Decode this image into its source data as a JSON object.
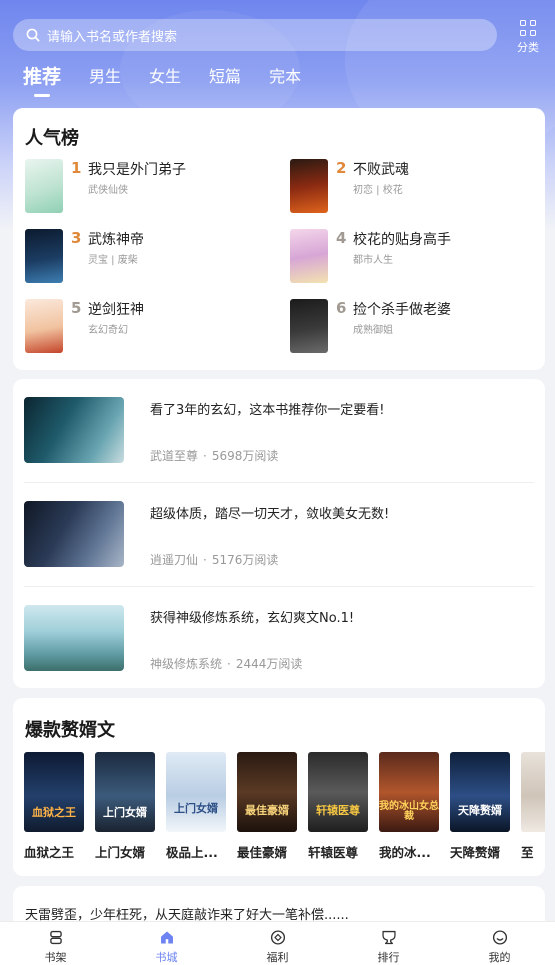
{
  "search": {
    "placeholder": "请输入书名或作者搜索"
  },
  "category": {
    "label": "分类"
  },
  "tabs": [
    {
      "label": "推荐",
      "active": true
    },
    {
      "label": "男生",
      "active": false
    },
    {
      "label": "女生",
      "active": false
    },
    {
      "label": "短篇",
      "active": false
    },
    {
      "label": "完本",
      "active": false
    }
  ],
  "ranking": {
    "title": "人气榜",
    "items": [
      {
        "rank": "1",
        "title": "我只是外门弟子",
        "tags": "武侠仙侠"
      },
      {
        "rank": "2",
        "title": "不败武魂",
        "tags": "初恋 | 校花"
      },
      {
        "rank": "3",
        "title": "武炼神帝",
        "tags": "灵宝 | 废柴"
      },
      {
        "rank": "4",
        "title": "校花的贴身高手",
        "tags": "都市人生"
      },
      {
        "rank": "5",
        "title": "逆剑狂神",
        "tags": "玄幻奇幻"
      },
      {
        "rank": "6",
        "title": "捡个杀手做老婆",
        "tags": "成熟御姐"
      }
    ]
  },
  "featured": [
    {
      "title": "看了3年的玄幻，这本书推荐你一定要看!",
      "book": "武道至尊",
      "reads": "5698万阅读"
    },
    {
      "title": "超级体质，踏尽一切天才，敛收美女无数!",
      "book": "逍遥刀仙",
      "reads": "5176万阅读"
    },
    {
      "title": "获得神级修炼系统，玄幻爽文No.1!",
      "book": "神级修炼系统",
      "reads": "2444万阅读"
    }
  ],
  "meta_separator": "·",
  "hot": {
    "title": "爆款赘婿文",
    "items": [
      {
        "name": "血狱之王",
        "cover_text": "血狱之王"
      },
      {
        "name": "上门女婿",
        "cover_text": "上门女婿"
      },
      {
        "name": "极品上...",
        "cover_text": "上门女婿"
      },
      {
        "name": "最佳豪婿",
        "cover_text": "最佳豪婿"
      },
      {
        "name": "轩辕医尊",
        "cover_text": "轩辕医尊"
      },
      {
        "name": "我的冰...",
        "cover_text": "我的冰山女总裁"
      },
      {
        "name": "天降赘婿",
        "cover_text": "天降赘婿"
      },
      {
        "name": "至",
        "cover_text": "至"
      }
    ]
  },
  "promo": {
    "text": "天雷劈歪，少年枉死，从天庭敲诈来了好大一笔补偿......"
  },
  "nav": [
    {
      "label": "书架",
      "icon": "bookshelf-icon",
      "active": false
    },
    {
      "label": "书城",
      "icon": "home-icon",
      "active": true
    },
    {
      "label": "福利",
      "icon": "gift-icon",
      "active": false
    },
    {
      "label": "排行",
      "icon": "trophy-icon",
      "active": false
    },
    {
      "label": "我的",
      "icon": "profile-icon",
      "active": false
    }
  ],
  "colors": {
    "accent": "#6d83f2",
    "rank_top": "#e0893a",
    "rank_other": "#a09a92"
  }
}
